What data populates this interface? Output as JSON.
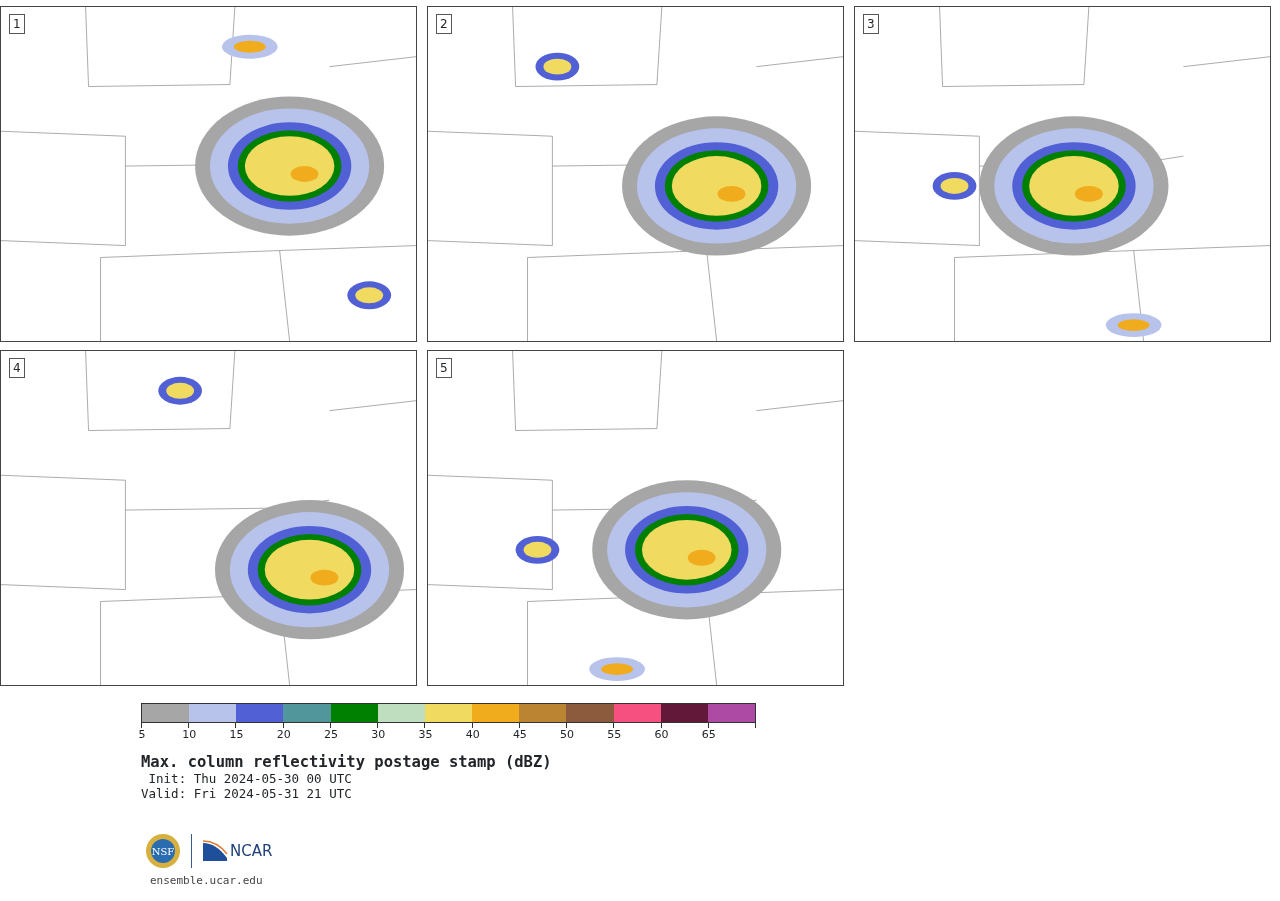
{
  "panels": [
    {
      "label": "1"
    },
    {
      "label": "2"
    },
    {
      "label": "3"
    },
    {
      "label": "4"
    },
    {
      "label": "5"
    }
  ],
  "colorbar": {
    "segments": [
      {
        "color": "#a6a6a6"
      },
      {
        "color": "#b8c3ec"
      },
      {
        "color": "#5260d6"
      },
      {
        "color": "#50969a"
      },
      {
        "color": "#008000"
      },
      {
        "color": "#bfddbf"
      },
      {
        "color": "#f0da60"
      },
      {
        "color": "#f0ac1c"
      },
      {
        "color": "#ba8432"
      },
      {
        "color": "#8c5a3c"
      },
      {
        "color": "#f55080"
      },
      {
        "color": "#621838"
      },
      {
        "color": "#ac4aa4"
      }
    ],
    "ticks": [
      "5",
      "10",
      "15",
      "20",
      "25",
      "30",
      "35",
      "40",
      "45",
      "50",
      "55",
      "60",
      "65"
    ]
  },
  "title": "Max. column reflectivity postage stamp (dBZ)",
  "init": " Init: Thu 2024-05-30 00 UTC",
  "valid": "Valid: Fri 2024-05-31 21 UTC",
  "logos": {
    "left": "NSF",
    "right": "NCAR"
  },
  "site": "ensemble.ucar.edu"
}
